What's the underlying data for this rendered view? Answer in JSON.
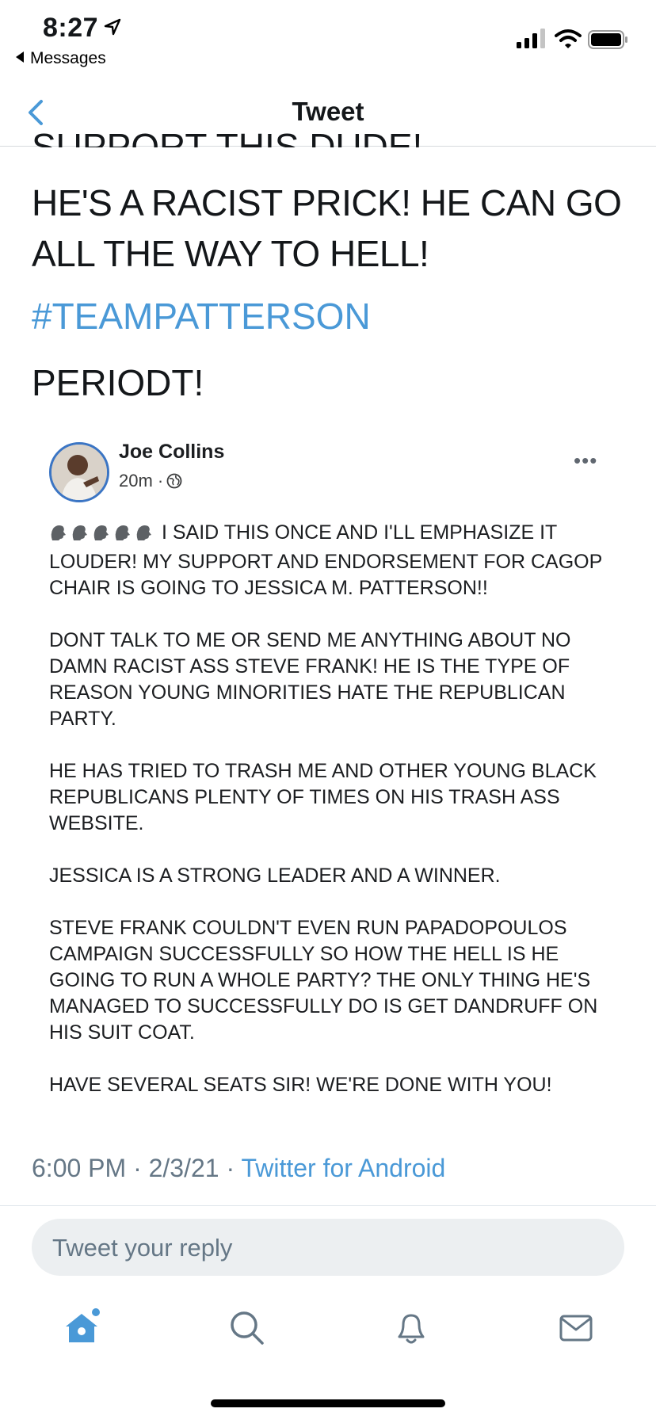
{
  "status_bar": {
    "time": "8:27",
    "back_app": "Messages"
  },
  "header": {
    "title": "Tweet"
  },
  "tweet": {
    "clipped_line": "SUPPORT THIS DUDE!",
    "text": "HE'S A RACIST PRICK! HE CAN GO ALL THE WAY TO HELL!",
    "hashtag": "#TEAMPATTERSON",
    "closing": "PERIODT!",
    "time": "6:00 PM",
    "date": "2/3/21",
    "source": "Twitter for Android"
  },
  "embedded_post": {
    "author": "Joe Collins",
    "age": "20m",
    "paragraphs": [
      "I SAID THIS ONCE AND I'LL EMPHASIZE IT LOUDER! MY SUPPORT AND ENDORSEMENT FOR CAGOP CHAIR IS GOING TO JESSICA M. PATTERSON!!",
      "DONT TALK TO ME OR SEND ME ANYTHING ABOUT NO DAMN RACIST ASS STEVE FRANK! HE IS THE TYPE OF REASON YOUNG MINORITIES HATE THE REPUBLICAN PARTY.",
      "HE HAS TRIED TO TRASH ME AND OTHER YOUNG BLACK REPUBLICANS PLENTY OF TIMES ON HIS TRASH ASS WEBSITE.",
      "JESSICA IS A STRONG LEADER AND A WINNER.",
      "STEVE FRANK COULDN'T EVEN RUN PAPADOPOULOS CAMPAIGN SUCCESSFULLY SO HOW THE HELL IS HE GOING TO RUN A WHOLE PARTY? THE ONLY THING HE'S MANAGED TO SUCCESSFULLY DO IS GET DANDRUFF ON HIS SUIT COAT.",
      "HAVE SEVERAL SEATS SIR! WE'RE DONE WITH YOU!"
    ]
  },
  "reply": {
    "placeholder": "Tweet your reply"
  },
  "tab_bar": {
    "items": [
      "home-icon",
      "search-icon",
      "bell-icon",
      "mail-icon"
    ]
  },
  "colors": {
    "accent": "#4a99d7",
    "text": "#14171a",
    "muted": "#657786"
  }
}
